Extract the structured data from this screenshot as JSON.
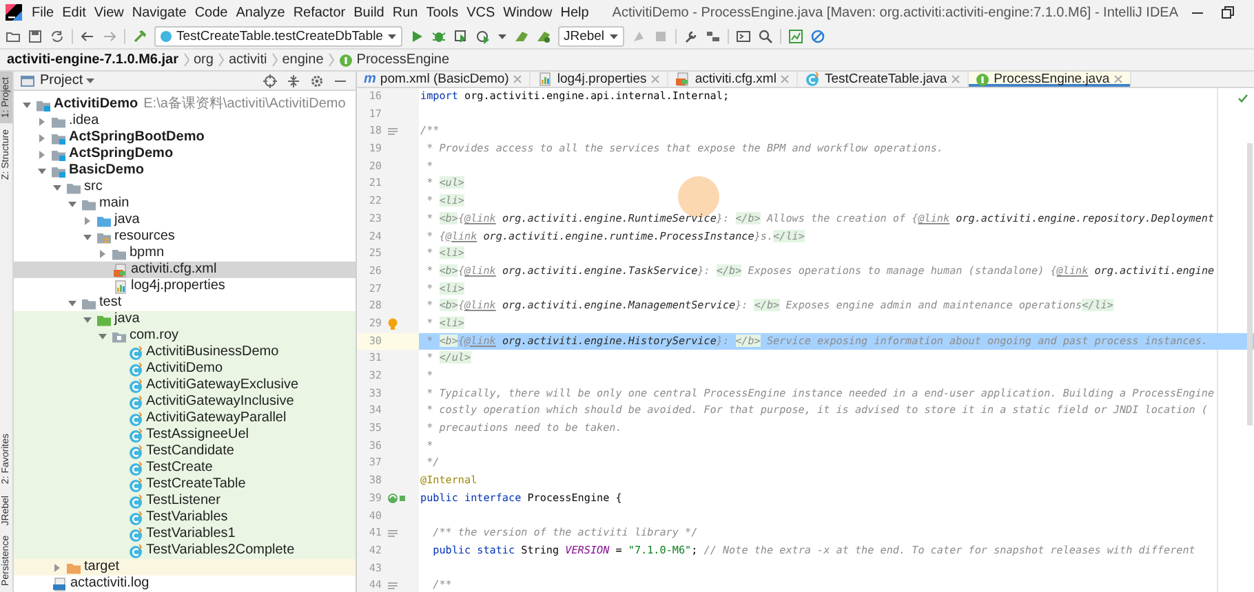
{
  "window": {
    "title": "ActivitiDemo - ProcessEngine.java [Maven: org.activiti:activiti-engine:7.1.0.M6] - IntelliJ IDEA"
  },
  "menu": [
    "File",
    "Edit",
    "View",
    "Navigate",
    "Code",
    "Analyze",
    "Refactor",
    "Build",
    "Run",
    "Tools",
    "VCS",
    "Window",
    "Help"
  ],
  "toolbar": {
    "run_config": "TestCreateTable.testCreateDbTable",
    "jrebel": "JRebel"
  },
  "breadcrumbs": [
    {
      "label": "activiti-engine-7.1.0.M6.jar",
      "kind": "jar"
    },
    {
      "label": "org",
      "kind": "package"
    },
    {
      "label": "activiti",
      "kind": "package"
    },
    {
      "label": "engine",
      "kind": "package"
    },
    {
      "label": "ProcessEngine",
      "kind": "interface"
    }
  ],
  "tool_stripe": {
    "top": [
      {
        "label": "1: Project",
        "active": true
      },
      {
        "label": "Z: Structure",
        "active": false
      }
    ],
    "bottom": [
      {
        "label": "2: Favorites",
        "active": false
      },
      {
        "label": "JRebel",
        "active": false
      },
      {
        "label": "Persistence",
        "active": false
      }
    ]
  },
  "project": {
    "title": "Project",
    "tree": [
      {
        "label": "ActivitiDemo",
        "path": "E:\\a备课资料\\activiti\\ActivitiDemo",
        "kind": "module",
        "expanded": true,
        "selected": false,
        "children": [
          {
            "label": ".idea",
            "kind": "folder",
            "expanded": false,
            "selected": false
          },
          {
            "label": "ActSpringBootDemo",
            "kind": "module",
            "expanded": false,
            "selected": false
          },
          {
            "label": "ActSpringDemo",
            "kind": "module",
            "expanded": false,
            "selected": false
          },
          {
            "label": "BasicDemo",
            "kind": "module",
            "expanded": true,
            "selected": false,
            "children": [
              {
                "label": "src",
                "kind": "folder",
                "expanded": true,
                "selected": false,
                "children": [
                  {
                    "label": "main",
                    "kind": "folder",
                    "expanded": true,
                    "selected": false,
                    "children": [
                      {
                        "label": "java",
                        "kind": "source-root",
                        "expanded": false,
                        "selected": false
                      },
                      {
                        "label": "resources",
                        "kind": "resources-root",
                        "expanded": true,
                        "selected": false,
                        "children": [
                          {
                            "label": "bpmn",
                            "kind": "folder",
                            "expanded": false,
                            "selected": false
                          },
                          {
                            "label": "activiti.cfg.xml",
                            "kind": "xml",
                            "selected": true
                          },
                          {
                            "label": "log4j.properties",
                            "kind": "properties",
                            "selected": false
                          }
                        ]
                      }
                    ]
                  },
                  {
                    "label": "test",
                    "kind": "folder",
                    "expanded": true,
                    "selected": false,
                    "children": [
                      {
                        "label": "java",
                        "kind": "test-root",
                        "expanded": true,
                        "selected": false,
                        "children": [
                          {
                            "label": "com.roy",
                            "kind": "package",
                            "expanded": true,
                            "selected": false,
                            "children": [
                              {
                                "label": "ActivitiBusinessDemo",
                                "kind": "class",
                                "selected": false
                              },
                              {
                                "label": "ActivitiDemo",
                                "kind": "class",
                                "selected": false
                              },
                              {
                                "label": "ActivitiGatewayExclusive",
                                "kind": "class",
                                "selected": false
                              },
                              {
                                "label": "ActivitiGatewayInclusive",
                                "kind": "class",
                                "selected": false
                              },
                              {
                                "label": "ActivitiGatewayParallel",
                                "kind": "class",
                                "selected": false
                              },
                              {
                                "label": "TestAssigneeUel",
                                "kind": "class",
                                "selected": false
                              },
                              {
                                "label": "TestCandidate",
                                "kind": "class",
                                "selected": false
                              },
                              {
                                "label": "TestCreate",
                                "kind": "class",
                                "selected": false
                              },
                              {
                                "label": "TestCreateTable",
                                "kind": "class",
                                "selected": false
                              },
                              {
                                "label": "TestListener",
                                "kind": "class",
                                "selected": false
                              },
                              {
                                "label": "TestVariables",
                                "kind": "class",
                                "selected": false
                              },
                              {
                                "label": "TestVariables1",
                                "kind": "class",
                                "selected": false
                              },
                              {
                                "label": "TestVariables2Complete",
                                "kind": "class",
                                "selected": false
                              }
                            ]
                          }
                        ]
                      }
                    ]
                  }
                ]
              },
              {
                "label": "target",
                "kind": "excluded",
                "expanded": false,
                "selected": false
              }
            ]
          },
          {
            "label": "actactiviti.log",
            "kind": "log",
            "selected": false
          }
        ]
      }
    ]
  },
  "editor": {
    "tabs": [
      {
        "label": "pom.xml (BasicDemo)",
        "kind": "maven",
        "icon_text": "m",
        "selected": false
      },
      {
        "label": "log4j.properties",
        "kind": "properties",
        "selected": false
      },
      {
        "label": "activiti.cfg.xml",
        "kind": "xml",
        "selected": false
      },
      {
        "label": "TestCreateTable.java",
        "kind": "class",
        "selected": false
      },
      {
        "label": "ProcessEngine.java",
        "kind": "interface",
        "selected": true
      }
    ],
    "lines": [
      {
        "number": "16",
        "kind": "plain",
        "current": false,
        "segments": [
          {
            "kind": "keyword",
            "text": "import"
          },
          {
            "kind": "plain",
            "text": " org.activiti.engine.api.internal.Internal;"
          }
        ]
      },
      {
        "number": "17",
        "kind": "plain",
        "current": false
      },
      {
        "number": "18",
        "kind": "doc",
        "current": false,
        "segments": [
          {
            "kind": "comment",
            "text": "/**"
          }
        ]
      },
      {
        "number": "19",
        "kind": "plain",
        "current": false,
        "segments": [
          {
            "kind": "comment",
            "text": " * Provides access to all the services that expose the BPM and workflow operations."
          }
        ]
      },
      {
        "number": "20",
        "kind": "plain",
        "current": false,
        "segments": [
          {
            "kind": "comment",
            "text": " *"
          }
        ]
      },
      {
        "number": "21",
        "kind": "plain",
        "current": false,
        "segments": [
          {
            "kind": "comment",
            "text": " * "
          },
          {
            "kind": "tag",
            "text": "<ul>"
          }
        ]
      },
      {
        "number": "22",
        "kind": "plain",
        "current": false,
        "segments": [
          {
            "kind": "comment",
            "text": " * "
          },
          {
            "kind": "tag",
            "text": "<li>"
          }
        ]
      },
      {
        "number": "23",
        "kind": "plain",
        "current": false,
        "segments": [
          {
            "kind": "comment",
            "text": " * "
          },
          {
            "kind": "tag",
            "text": "<b>"
          },
          {
            "kind": "comment",
            "text": "{"
          },
          {
            "kind": "doctag",
            "text": "@link"
          },
          {
            "kind": "ref",
            "text": " org.activiti.engine.RuntimeService"
          },
          {
            "kind": "comment",
            "text": "}: "
          },
          {
            "kind": "tag",
            "text": "</b>"
          },
          {
            "kind": "comment",
            "text": " Allows the creation of {"
          },
          {
            "kind": "doctag",
            "text": "@link"
          },
          {
            "kind": "ref",
            "text": " org.activiti.engine.repository.Deployment"
          }
        ]
      },
      {
        "number": "24",
        "kind": "plain",
        "current": false,
        "segments": [
          {
            "kind": "comment",
            "text": " * {"
          },
          {
            "kind": "doctag",
            "text": "@link"
          },
          {
            "kind": "ref",
            "text": " org.activiti.engine.runtime.ProcessInstance"
          },
          {
            "kind": "comment",
            "text": "}s."
          },
          {
            "kind": "tag",
            "text": "</li>"
          }
        ]
      },
      {
        "number": "25",
        "kind": "plain",
        "current": false,
        "segments": [
          {
            "kind": "comment",
            "text": " * "
          },
          {
            "kind": "tag",
            "text": "<li>"
          }
        ]
      },
      {
        "number": "26",
        "kind": "plain",
        "current": false,
        "segments": [
          {
            "kind": "comment",
            "text": " * "
          },
          {
            "kind": "tag",
            "text": "<b>"
          },
          {
            "kind": "comment",
            "text": "{"
          },
          {
            "kind": "doctag",
            "text": "@link"
          },
          {
            "kind": "ref",
            "text": " org.activiti.engine.TaskService"
          },
          {
            "kind": "comment",
            "text": "}: "
          },
          {
            "kind": "tag",
            "text": "</b>"
          },
          {
            "kind": "comment",
            "text": " Exposes operations to manage human (standalone) {"
          },
          {
            "kind": "doctag",
            "text": "@link"
          },
          {
            "kind": "ref",
            "text": " org.activiti.engine"
          }
        ]
      },
      {
        "number": "27",
        "kind": "plain",
        "current": false,
        "segments": [
          {
            "kind": "comment",
            "text": " * "
          },
          {
            "kind": "tag",
            "text": "<li>"
          }
        ]
      },
      {
        "number": "28",
        "kind": "plain",
        "current": false,
        "segments": [
          {
            "kind": "comment",
            "text": " * "
          },
          {
            "kind": "tag",
            "text": "<b>"
          },
          {
            "kind": "comment",
            "text": "{"
          },
          {
            "kind": "doctag",
            "text": "@link"
          },
          {
            "kind": "ref",
            "text": " org.activiti.engine.ManagementService"
          },
          {
            "kind": "comment",
            "text": "}: "
          },
          {
            "kind": "tag",
            "text": "</b>"
          },
          {
            "kind": "comment",
            "text": " Exposes engine admin and maintenance operations"
          },
          {
            "kind": "tag",
            "text": "</li>"
          }
        ]
      },
      {
        "number": "29",
        "kind": "bulb",
        "current": false,
        "segments": [
          {
            "kind": "comment",
            "text": " * "
          },
          {
            "kind": "tag",
            "text": "<li>"
          }
        ]
      },
      {
        "number": "30",
        "kind": "plain",
        "current": true,
        "segments": [
          {
            "kind": "comment",
            "text": " * "
          },
          {
            "kind": "tag",
            "text": "<b>"
          },
          {
            "kind": "comment",
            "text": "{"
          },
          {
            "kind": "doctag",
            "text": "@link"
          },
          {
            "kind": "ref",
            "text": " org.activiti.engine.HistoryService"
          },
          {
            "kind": "comment",
            "text": "}: "
          },
          {
            "kind": "tag",
            "text": "</b>"
          },
          {
            "kind": "comment",
            "text": " Service exposing information about ongoing and past process instances."
          }
        ]
      },
      {
        "number": "31",
        "kind": "plain",
        "current": false,
        "segments": [
          {
            "kind": "comment",
            "text": " * "
          },
          {
            "kind": "tag",
            "text": "</ul>"
          }
        ]
      },
      {
        "number": "32",
        "kind": "plain",
        "current": false,
        "segments": [
          {
            "kind": "comment",
            "text": " *"
          }
        ]
      },
      {
        "number": "33",
        "kind": "plain",
        "current": false,
        "segments": [
          {
            "kind": "comment",
            "text": " * Typically, there will be only one central ProcessEngine instance needed in a end-user application. Building a ProcessEngine"
          }
        ]
      },
      {
        "number": "34",
        "kind": "plain",
        "current": false,
        "segments": [
          {
            "kind": "comment",
            "text": " * costly operation which should be avoided. For that purpose, it is advised to store it in a static field or JNDI location ("
          }
        ]
      },
      {
        "number": "35",
        "kind": "plain",
        "current": false,
        "segments": [
          {
            "kind": "comment",
            "text": " * precautions need to be taken."
          }
        ]
      },
      {
        "number": "36",
        "kind": "plain",
        "current": false,
        "segments": [
          {
            "kind": "comment",
            "text": " *"
          }
        ]
      },
      {
        "number": "37",
        "kind": "plain",
        "current": false,
        "segments": [
          {
            "kind": "comment",
            "text": " */"
          }
        ]
      },
      {
        "number": "38",
        "kind": "plain",
        "current": false,
        "segments": [
          {
            "kind": "annotation",
            "text": "@Internal"
          }
        ]
      },
      {
        "number": "39",
        "kind": "implemented",
        "current": false,
        "segments": [
          {
            "kind": "keyword",
            "text": "public interface"
          },
          {
            "kind": "plain",
            "text": " ProcessEngine {"
          }
        ]
      },
      {
        "number": "40",
        "kind": "plain",
        "current": false
      },
      {
        "number": "41",
        "kind": "doc",
        "current": false,
        "segments": [
          {
            "kind": "comment",
            "text": "  /** the version of the activiti library */"
          }
        ]
      },
      {
        "number": "42",
        "kind": "plain",
        "current": false,
        "segments": [
          {
            "kind": "keyword",
            "text": "  public static"
          },
          {
            "kind": "plain",
            "text": " String "
          },
          {
            "kind": "field",
            "text": "VERSION"
          },
          {
            "kind": "plain",
            "text": " = "
          },
          {
            "kind": "string",
            "text": "\"7.1.0-M6\""
          },
          {
            "kind": "plain",
            "text": "; "
          },
          {
            "kind": "comment",
            "text": "// Note the extra -x at the end. To cater for snapshot releases with different"
          }
        ]
      },
      {
        "number": "43",
        "kind": "plain",
        "current": false
      },
      {
        "number": "44",
        "kind": "doc",
        "current": false,
        "segments": [
          {
            "kind": "comment",
            "text": "  /**"
          }
        ]
      }
    ]
  }
}
